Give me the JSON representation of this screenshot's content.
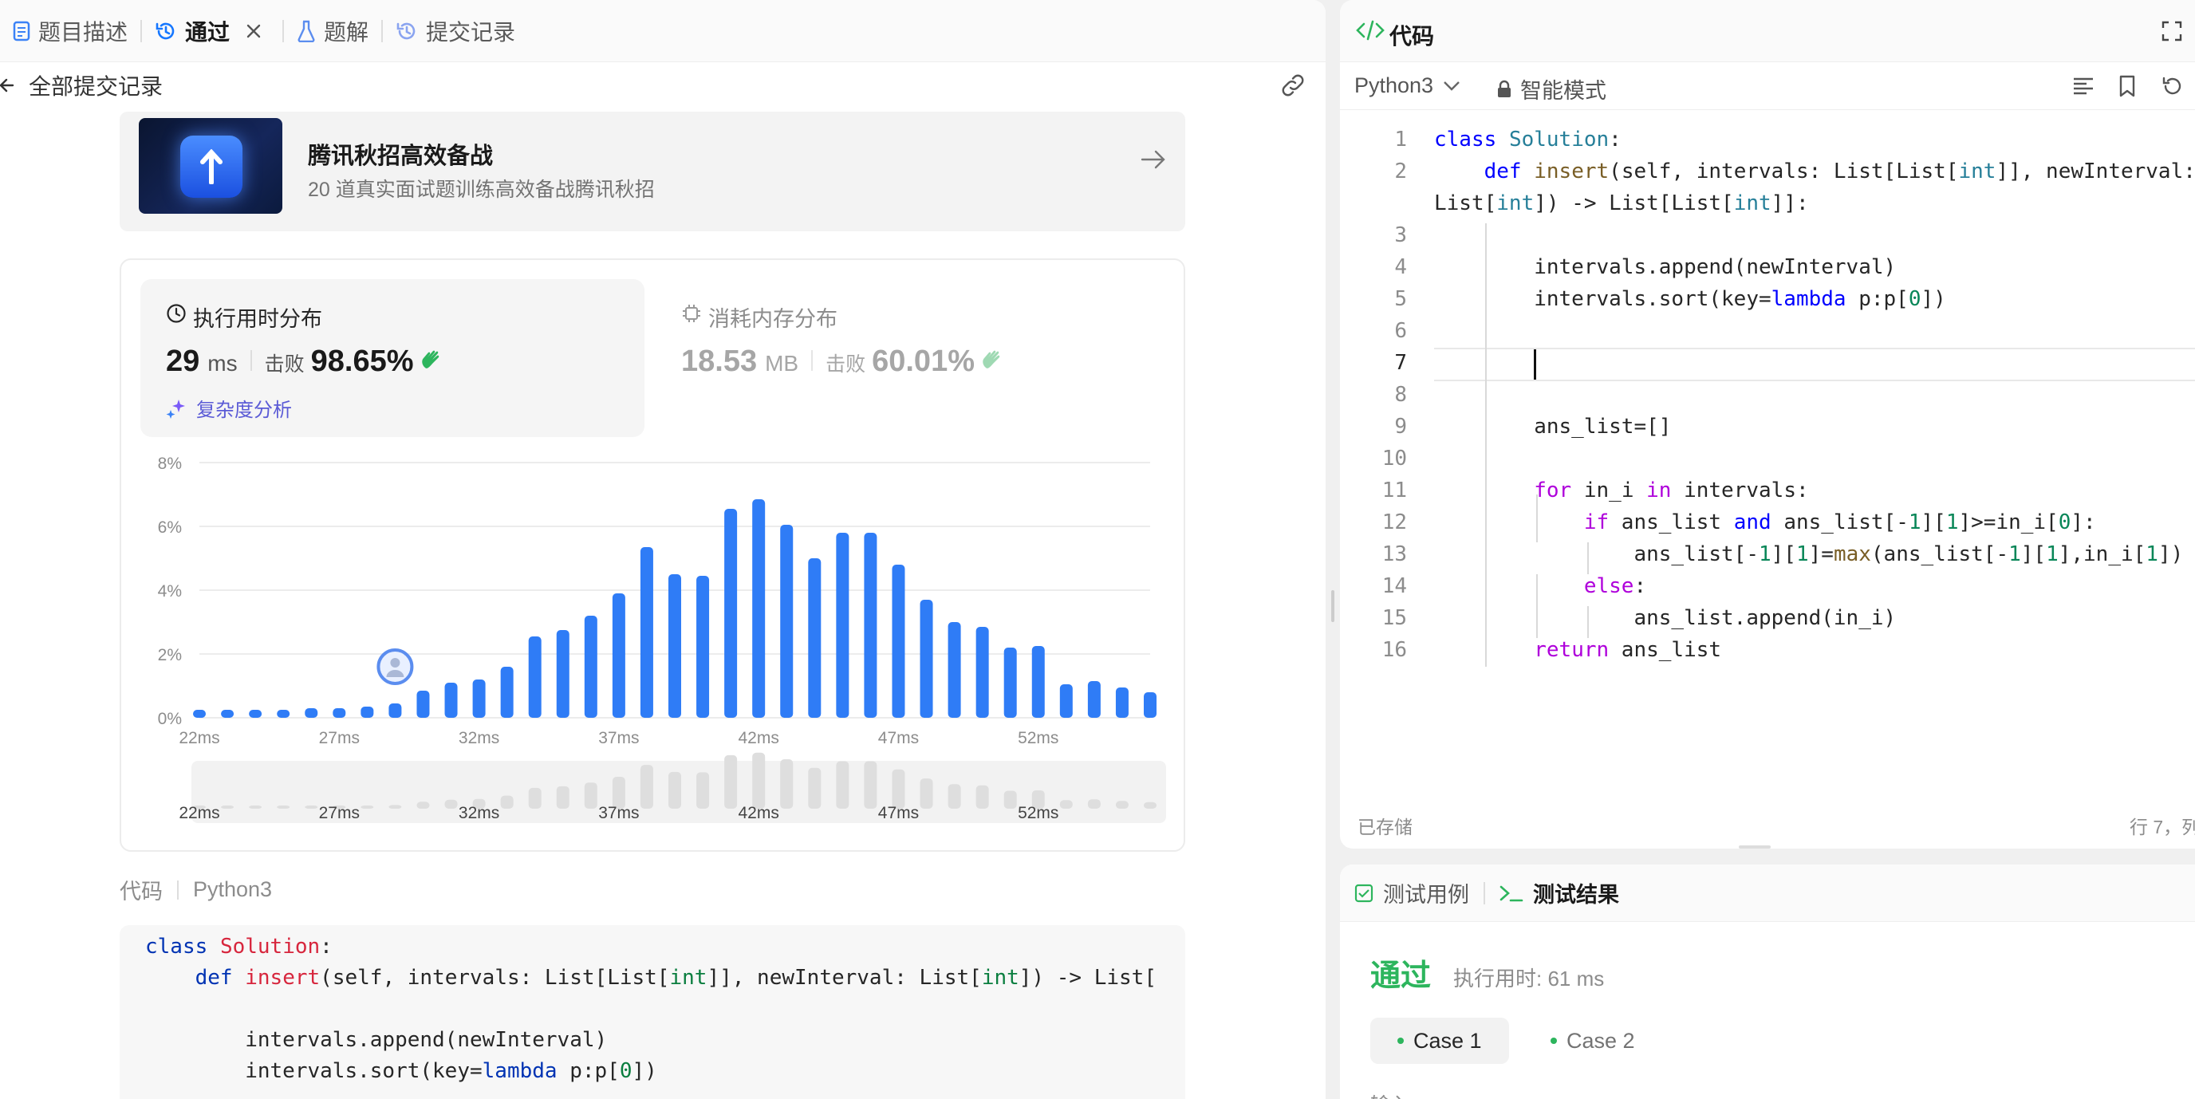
{
  "tabs": [
    {
      "label": "题目描述"
    },
    {
      "label": "通过"
    },
    {
      "label": "题解"
    },
    {
      "label": "提交记录"
    }
  ],
  "subbar": {
    "back_label": "全部提交记录"
  },
  "promo": {
    "title": "腾讯秋招高效备战",
    "subtitle": "20 道真实面试题训练高效备战腾讯秋招"
  },
  "runtime": {
    "title": "执行用时分布",
    "value": "29",
    "unit": "ms",
    "beats_label": "击败",
    "beats": "98.65%",
    "analysis_label": "复杂度分析"
  },
  "memory": {
    "title": "消耗内存分布",
    "value": "18.53",
    "unit": "MB",
    "beats_label": "击败",
    "beats": "60.01%"
  },
  "chart_data": {
    "type": "bar",
    "xlabel": "",
    "ylabel": "",
    "ylim": [
      0,
      8
    ],
    "y_ticks": [
      "0%",
      "2%",
      "4%",
      "6%",
      "8%"
    ],
    "x_ticks": [
      "22ms",
      "27ms",
      "32ms",
      "37ms",
      "42ms",
      "47ms",
      "52ms"
    ],
    "x_range": [
      22,
      56
    ],
    "x": [
      22,
      23,
      24,
      25,
      26,
      27,
      28,
      29,
      30,
      31,
      32,
      33,
      34,
      35,
      36,
      37,
      38,
      39,
      40,
      41,
      42,
      43,
      44,
      45,
      46,
      47,
      48,
      49,
      50,
      51,
      52,
      53,
      54,
      55,
      56
    ],
    "values": [
      0.25,
      0.25,
      0.25,
      0.25,
      0.3,
      0.3,
      0.35,
      0.45,
      0.85,
      1.1,
      1.2,
      1.6,
      2.55,
      2.75,
      3.2,
      3.9,
      5.35,
      4.5,
      4.45,
      6.55,
      6.85,
      6.05,
      5.0,
      5.8,
      5.8,
      4.8,
      3.7,
      3.0,
      2.85,
      2.2,
      2.25,
      1.05,
      1.15,
      0.95,
      0.8
    ],
    "marker_x": 29,
    "bar_color": "#2f7cf6",
    "grid": true
  },
  "code_section": {
    "label": "代码",
    "lang": "Python3"
  },
  "code_preview": [
    "class Solution:",
    "    def insert(self, intervals: List[List[int]], newInterval: List[int]) -> List[",
    "",
    "        intervals.append(newInterval)",
    "        intervals.sort(key=lambda p:p[0])"
  ],
  "editor": {
    "title": "代码",
    "lang": "Python3",
    "mode": "智能模式",
    "saved": "已存储",
    "cursor": "行 7，列",
    "lines": [
      "1",
      "2",
      "",
      "3",
      "4",
      "5",
      "6",
      "7",
      "8",
      "9",
      "10",
      "11",
      "12",
      "13",
      "14",
      "15",
      "16"
    ]
  },
  "bottom": {
    "tab_cases": "测试用例",
    "tab_results": "测试结果",
    "status": "通过",
    "time_label": "执行用时: 61 ms",
    "cases": [
      "Case 1",
      "Case 2"
    ],
    "input_label": "输入"
  },
  "colors": {
    "accent": "#2f7cf6",
    "success": "#2db55d",
    "purple": "#7a5af8"
  }
}
